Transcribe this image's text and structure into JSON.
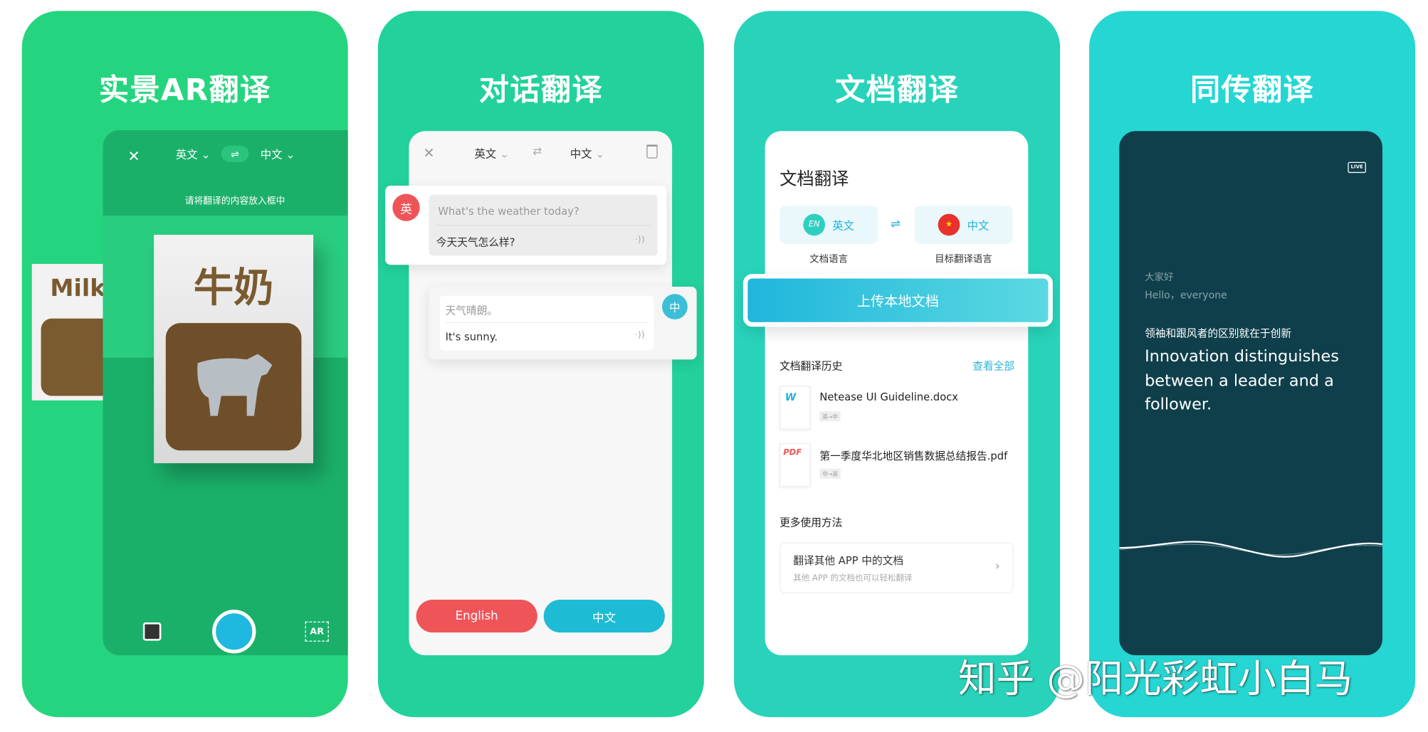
{
  "colors": {
    "panel_ar": "#25d47f",
    "panel_dialog": "#22d19c",
    "panel_doc": "#28d3ba",
    "panel_live": "#25d6d3",
    "live_card": "#0f3f4b",
    "red": "#ef5558",
    "teal": "#1dbbd4"
  },
  "ar": {
    "title": "实景AR翻译",
    "close": "✕",
    "source_lang": "英文",
    "target_lang": "中文",
    "swap": "⇌",
    "hint": "请将翻译的内容放入框中",
    "sign_text": "牛奶",
    "side_sign_text": "Milk",
    "ar_button": "AR"
  },
  "dialog": {
    "title": "对话翻译",
    "source_lang": "英文",
    "target_lang": "中文",
    "messages": [
      {
        "avatar": "英",
        "original": "What's the weather today?",
        "translation": "今天天气怎么样?"
      },
      {
        "avatar": "中",
        "original": "天气晴朗。",
        "translation": "It's sunny."
      }
    ],
    "buttons": {
      "english": "English",
      "chinese": "中文"
    }
  },
  "doc": {
    "title": "文档翻译",
    "heading": "文档翻译",
    "source": {
      "badge": "EN",
      "lang": "英文",
      "label": "文档语言"
    },
    "target": {
      "lang": "中文",
      "label": "目标翻译语言"
    },
    "upload": "上传本地文档",
    "history_title": "文档翻译历史",
    "view_all": "查看全部",
    "files": [
      {
        "icon": "W",
        "name": "Netease UI Guideline.docx",
        "tag": "英→中"
      },
      {
        "icon": "PDF",
        "name": "第一季度华北地区销售数据总结报告.pdf",
        "tag": "中→英"
      }
    ],
    "more_title": "更多使用方法",
    "more_item": {
      "title": "翻译其他 APP 中的文档",
      "subtitle": "其他 APP 的文档也可以轻松翻译"
    }
  },
  "live": {
    "title": "同传翻译",
    "live_badge": "LIVE",
    "lines": [
      {
        "zh": "大家好",
        "en": "Hello，everyone"
      }
    ],
    "current_zh": "领袖和跟风者的区别就在于创新",
    "current_en": "Innovation distinguishes between a leader and a follower."
  },
  "watermark": "知乎 @阳光彩虹小白马"
}
